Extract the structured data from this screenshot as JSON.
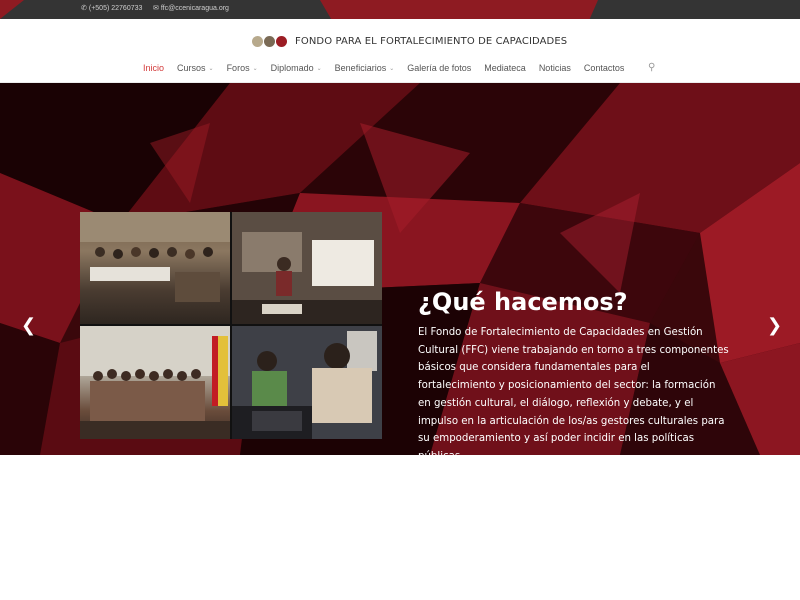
{
  "topbar": {
    "phone": "(+505) 22760733",
    "email": "ffc@ccenicaragua.org",
    "phone_icon": "phone-icon",
    "email_icon": "envelope-icon"
  },
  "header": {
    "logo_icon": "ffc-logo-icon",
    "site_name": "FONDO PARA EL FORTALECIMIENTO DE CAPACIDADES"
  },
  "nav": {
    "items": [
      {
        "label": "Inicio",
        "active": true,
        "dropdown": false
      },
      {
        "label": "Cursos",
        "dropdown": true
      },
      {
        "label": "Foros",
        "dropdown": true
      },
      {
        "label": "Diplomado",
        "dropdown": true
      },
      {
        "label": "Beneficiarios",
        "dropdown": true
      },
      {
        "label": "Galería de fotos",
        "dropdown": false
      },
      {
        "label": "Mediateca",
        "dropdown": false
      },
      {
        "label": "Noticias",
        "dropdown": false
      },
      {
        "label": "Contactos",
        "dropdown": false
      }
    ],
    "search_icon": "search-icon",
    "active_color": "#d33a3a"
  },
  "hero": {
    "title": "¿Qué hacemos?",
    "text": "El Fondo de Fortalecimiento de Capacidades en Gestión Cultural (FFC) viene trabajando en torno a tres componentes básicos que considera fundamentales para el fortalecimiento y posicionamiento del sector: la formación en gestión cultural, el diálogo, reflexión y debate, y el impulso en la articulación de los/as gestores culturales para su empoderamiento y así poder incidir en las políticas públicas.",
    "prev_icon": "chevron-left-icon",
    "next_icon": "chevron-right-icon",
    "prev_glyph": "❮",
    "next_glyph": "❯",
    "accent_color": "#8e1b22"
  }
}
